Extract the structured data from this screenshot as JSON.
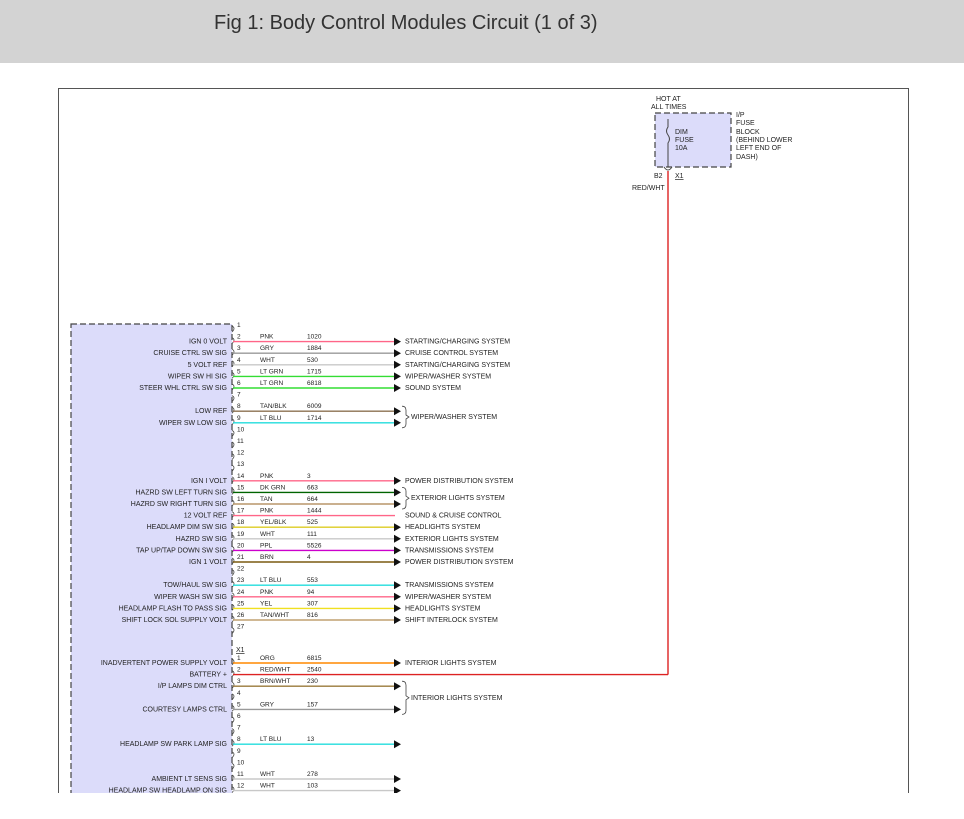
{
  "header": {
    "title": "Fig 1: Body Control Modules Circuit (1 of 3)"
  },
  "fuse": {
    "hot_label": [
      "HOT AT",
      "ALL TIMES"
    ],
    "fuse_label": [
      "DIM",
      "FUSE",
      "10A"
    ],
    "block_label": [
      "I/P",
      "FUSE",
      "BLOCK",
      "(BEHIND LOWER",
      "LEFT END OF",
      "DASH)"
    ],
    "pin": "B2",
    "connector": "X1",
    "wire_color": "RED/WHT"
  },
  "connector2_label": "X1",
  "colors": {
    "PNK": "#ff6688",
    "GRY": "#9a9a9a",
    "WHT": "#c8c8c8",
    "LT GRN": "#33dd33",
    "TAN/BLK": "#8b7050",
    "LT BLU": "#22dddd",
    "DK GRN": "#006400",
    "TAN": "#b8966a",
    "YEL/BLK": "#ddcc22",
    "PPL": "#cc00cc",
    "BRN": "#7a5a10",
    "YEL": "#f0e020",
    "TAN/WHT": "#c0a070",
    "ORG": "#ff8800",
    "RED/WHT": "#dd2222",
    "BRN/WHT": "#9a7a3a"
  },
  "connector1": [
    {
      "pin": "1",
      "label": "",
      "color": "",
      "circuit": "",
      "dest": "",
      "arrow": false
    },
    {
      "pin": "2",
      "label": "IGN 0 VOLT",
      "color": "PNK",
      "circuit": "1020",
      "dest": "STARTING/CHARGING SYSTEM",
      "arrow": true
    },
    {
      "pin": "3",
      "label": "CRUISE CTRL SW SIG",
      "color": "GRY",
      "circuit": "1884",
      "dest": "CRUISE CONTROL SYSTEM",
      "arrow": true
    },
    {
      "pin": "4",
      "label": "5 VOLT REF",
      "color": "WHT",
      "circuit": "530",
      "dest": "STARTING/CHARGING SYSTEM",
      "arrow": true
    },
    {
      "pin": "5",
      "label": "WIPER SW HI SIG",
      "color": "LT GRN",
      "circuit": "1715",
      "dest": "WIPER/WASHER SYSTEM",
      "arrow": true
    },
    {
      "pin": "6",
      "label": "STEER WHL CTRL SW SIG",
      "color": "LT GRN",
      "circuit": "6818",
      "dest": "SOUND SYSTEM",
      "arrow": true
    },
    {
      "pin": "7",
      "label": "",
      "color": "",
      "circuit": "",
      "dest": "",
      "arrow": false
    },
    {
      "pin": "8",
      "label": "LOW REF",
      "color": "TAN/BLK",
      "circuit": "6009",
      "dest": "",
      "arrow": true
    },
    {
      "pin": "9",
      "label": "WIPER SW LOW SIG",
      "color": "LT BLU",
      "circuit": "1714",
      "dest": "",
      "arrow": true
    },
    {
      "pin": "10",
      "label": "",
      "color": "",
      "circuit": "",
      "dest": "",
      "arrow": false
    },
    {
      "pin": "11",
      "label": "",
      "color": "",
      "circuit": "",
      "dest": "",
      "arrow": false
    },
    {
      "pin": "12",
      "label": "",
      "color": "",
      "circuit": "",
      "dest": "",
      "arrow": false
    },
    {
      "pin": "13",
      "label": "",
      "color": "",
      "circuit": "",
      "dest": "",
      "arrow": false
    },
    {
      "pin": "14",
      "label": "IGN I VOLT",
      "color": "PNK",
      "circuit": "3",
      "dest": "POWER DISTRIBUTION SYSTEM",
      "arrow": true
    },
    {
      "pin": "15",
      "label": "HAZRD SW LEFT TURN SIG",
      "color": "DK GRN",
      "circuit": "663",
      "dest": "",
      "arrow": true
    },
    {
      "pin": "16",
      "label": "HAZRD SW RIGHT TURN SIG",
      "color": "TAN",
      "circuit": "664",
      "dest": "",
      "arrow": true
    },
    {
      "pin": "17",
      "label": "12 VOLT REF",
      "color": "PNK",
      "circuit": "1444",
      "dest": "",
      "arrow": false
    },
    {
      "pin": "18",
      "label": "HEADLAMP DIM SW SIG",
      "color": "YEL/BLK",
      "circuit": "525",
      "dest": "HEADLIGHTS SYSTEM",
      "arrow": true
    },
    {
      "pin": "19",
      "label": "HAZRD SW SIG",
      "color": "WHT",
      "circuit": "111",
      "dest": "EXTERIOR LIGHTS SYSTEM",
      "arrow": true
    },
    {
      "pin": "20",
      "label": "TAP UP/TAP DOWN SW SIG",
      "color": "PPL",
      "circuit": "5526",
      "dest": "TRANSMISSIONS SYSTEM",
      "arrow": true
    },
    {
      "pin": "21",
      "label": "IGN 1 VOLT",
      "color": "BRN",
      "circuit": "4",
      "dest": "POWER DISTRIBUTION SYSTEM",
      "arrow": true
    },
    {
      "pin": "22",
      "label": "",
      "color": "",
      "circuit": "",
      "dest": "",
      "arrow": false
    },
    {
      "pin": "23",
      "label": "TOW/HAUL SW SIG",
      "color": "LT BLU",
      "circuit": "553",
      "dest": "TRANSMISSIONS SYSTEM",
      "arrow": true
    },
    {
      "pin": "24",
      "label": "WIPER WASH SW SIG",
      "color": "PNK",
      "circuit": "94",
      "dest": "WIPER/WASHER SYSTEM",
      "arrow": true
    },
    {
      "pin": "25",
      "label": "HEADLAMP FLASH TO PASS SIG",
      "color": "YEL",
      "circuit": "307",
      "dest": "HEADLIGHTS SYSTEM",
      "arrow": true
    },
    {
      "pin": "26",
      "label": "SHIFT LOCK SOL SUPPLY VOLT",
      "color": "TAN/WHT",
      "circuit": "816",
      "dest": "SHIFT INTERLOCK SYSTEM",
      "arrow": true
    },
    {
      "pin": "27",
      "label": "",
      "color": "",
      "circuit": "",
      "dest": "",
      "arrow": false
    }
  ],
  "connector2": [
    {
      "pin": "1",
      "label": "INADVERTENT POWER SUPPLY VOLT",
      "color": "ORG",
      "circuit": "6815",
      "dest": "INTERIOR LIGHTS SYSTEM",
      "arrow": true
    },
    {
      "pin": "2",
      "label": "BATTERY +",
      "color": "RED/WHT",
      "circuit": "2540",
      "dest": "",
      "arrow": false
    },
    {
      "pin": "3",
      "label": "I/P LAMPS DIM CTRL",
      "color": "BRN/WHT",
      "circuit": "230",
      "dest": "",
      "arrow": true
    },
    {
      "pin": "4",
      "label": "",
      "color": "",
      "circuit": "",
      "dest": "",
      "arrow": false
    },
    {
      "pin": "5",
      "label": "COURTESY LAMPS CTRL",
      "color": "GRY",
      "circuit": "157",
      "dest": "",
      "arrow": true
    },
    {
      "pin": "6",
      "label": "",
      "color": "",
      "circuit": "",
      "dest": "",
      "arrow": false
    },
    {
      "pin": "7",
      "label": "",
      "color": "",
      "circuit": "",
      "dest": "",
      "arrow": false
    },
    {
      "pin": "8",
      "label": "HEADLAMP SW PARK LAMP SIG",
      "color": "LT BLU",
      "circuit": "13",
      "dest": "",
      "arrow": true
    },
    {
      "pin": "9",
      "label": "",
      "color": "",
      "circuit": "",
      "dest": "",
      "arrow": false
    },
    {
      "pin": "10",
      "label": "",
      "color": "",
      "circuit": "",
      "dest": "",
      "arrow": false
    },
    {
      "pin": "11",
      "label": "AMBIENT LT SENS SIG",
      "color": "WHT",
      "circuit": "278",
      "dest": "",
      "arrow": true
    },
    {
      "pin": "12",
      "label": "HEADLAMP SW HEADLAMP ON SIG",
      "color": "WHT",
      "circuit": "103",
      "dest": "",
      "arrow": true
    }
  ],
  "group_labels": [
    {
      "text": "WIPER/WASHER SYSTEM",
      "pins": [
        "8",
        "9"
      ],
      "conn": 1
    },
    {
      "text": "EXTERIOR LIGHTS SYSTEM",
      "pins": [
        "15",
        "16"
      ],
      "conn": 1
    },
    {
      "text": "SOUND & CRUISE CONTROL",
      "pins": [
        "17"
      ],
      "conn": 1
    },
    {
      "text": "INTERIOR LIGHTS SYSTEM",
      "pins": [
        "3",
        "5"
      ],
      "conn": 2
    }
  ]
}
